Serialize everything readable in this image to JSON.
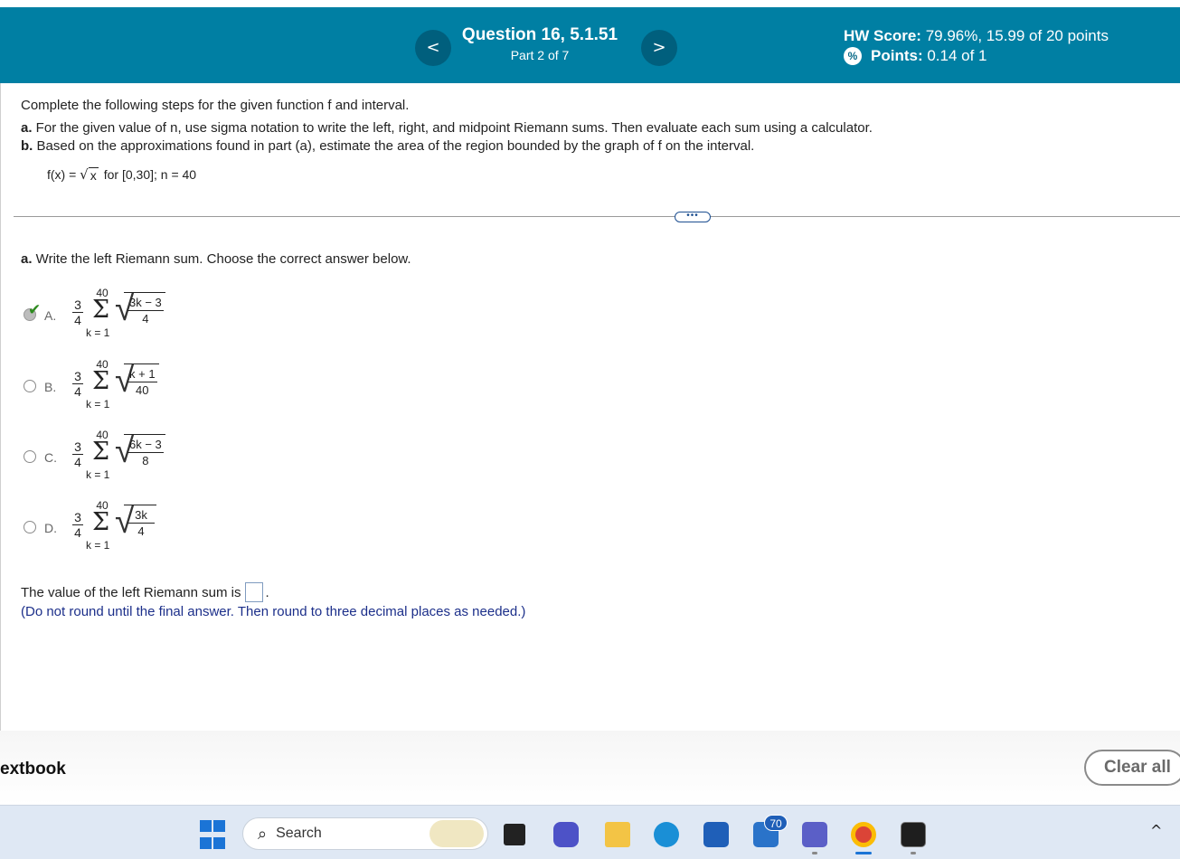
{
  "header": {
    "prev_label": "<",
    "next_label": ">",
    "question_title": "Question 16, 5.1.51",
    "part_label": "Part 2 of 7",
    "hw_score_label": "HW Score:",
    "hw_score_value": " 79.96%, 15.99 of 20 points",
    "points_label": "Points:",
    "points_value": " 0.14 of 1",
    "points_icon": "%"
  },
  "problem": {
    "intro": "Complete the following steps for the given function f and interval.",
    "part_a_letter": "a.",
    "part_a_text": " For the given value of n, use sigma notation to write the left, right, and midpoint Riemann sums. Then evaluate each sum using a calculator.",
    "part_b_letter": "b.",
    "part_b_text": " Based on the approximations found in part (a), estimate the area of the region bounded by the graph of f on the interval.",
    "function_prefix": "f(x) = ",
    "function_sqrt": "√",
    "function_radicand": "x",
    "function_suffix": "for [0,30]; n = 40",
    "more_label": "•••"
  },
  "question": {
    "letter": "a.",
    "text": " Write the left Riemann sum. Choose the correct answer below.",
    "options": [
      {
        "letter": "A.",
        "coef_num": "3",
        "coef_den": "4",
        "upper": "40",
        "lower": "k = 1",
        "rad_num": "3k − 3",
        "rad_den": "4",
        "selected": true,
        "check": "✔"
      },
      {
        "letter": "B.",
        "coef_num": "3",
        "coef_den": "4",
        "upper": "40",
        "lower": "k = 1",
        "rad_num": "k + 1",
        "rad_den": "40",
        "selected": false
      },
      {
        "letter": "C.",
        "coef_num": "3",
        "coef_den": "4",
        "upper": "40",
        "lower": "k = 1",
        "rad_num": "6k − 3",
        "rad_den": "8",
        "selected": false
      },
      {
        "letter": "D.",
        "coef_num": "3",
        "coef_den": "4",
        "upper": "40",
        "lower": "k = 1",
        "rad_num": "3k",
        "rad_den": "4",
        "selected": false
      }
    ],
    "sigma": "Σ",
    "radical": "√",
    "answer_prefix": "The value of the left Riemann sum is",
    "answer_value": "",
    "answer_suffix": ".",
    "note": "(Do not round until the final answer. Then round to three decimal places as needed.)"
  },
  "footer": {
    "textbook_label": "extbook",
    "clear_all_label": "Clear all"
  },
  "taskbar": {
    "search_icon": "⌕",
    "search_label": "Search",
    "mail_badge": "70",
    "chevron": "^"
  }
}
